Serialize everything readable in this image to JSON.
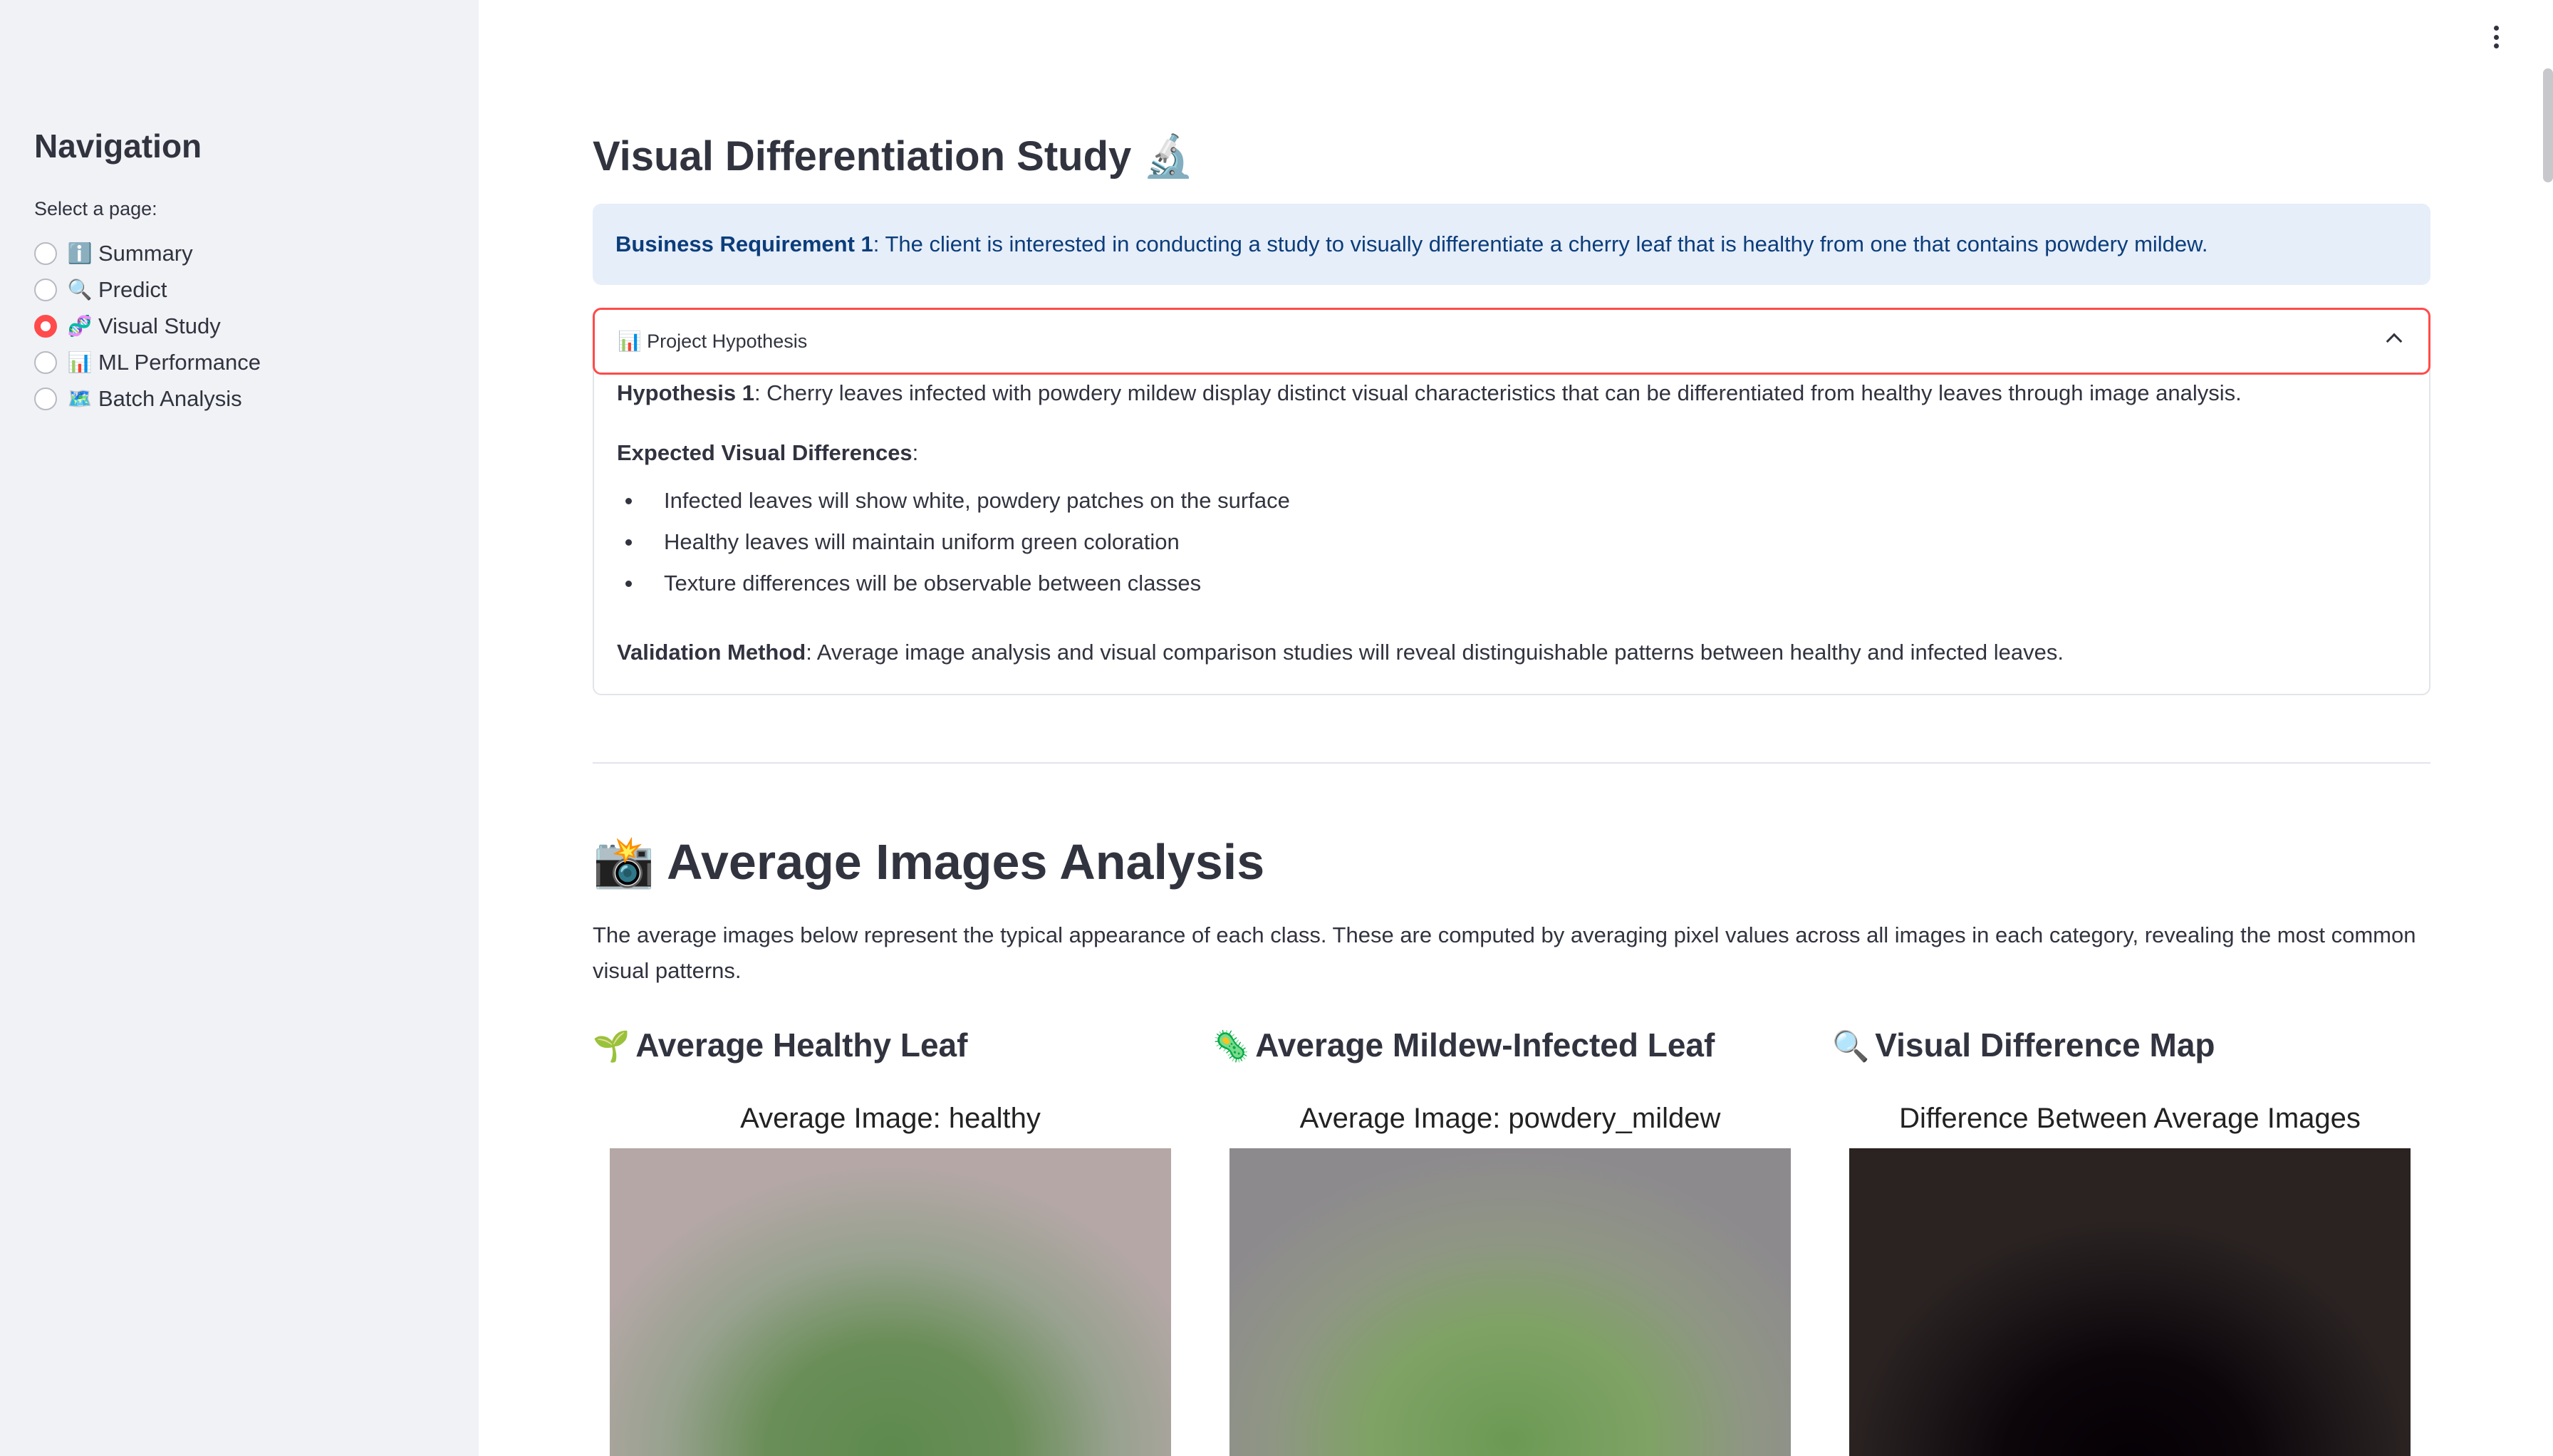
{
  "sidebar": {
    "title": "Navigation",
    "select_label": "Select a page:",
    "items": [
      {
        "icon": "ℹ️",
        "label": "Summary",
        "selected": false
      },
      {
        "icon": "🔍",
        "label": "Predict",
        "selected": false
      },
      {
        "icon": "🧬",
        "label": "Visual Study",
        "selected": true
      },
      {
        "icon": "📊",
        "label": "ML Performance",
        "selected": false
      },
      {
        "icon": "🗺️",
        "label": "Batch Analysis",
        "selected": false
      }
    ]
  },
  "main": {
    "title": "Visual Differentiation Study 🔬",
    "info": {
      "bold": "Business Requirement 1",
      "text": ": The client is interested in conducting a study to visually differentiate a cherry leaf that is healthy from one that contains powdery mildew."
    },
    "expander": {
      "header": "📊 Project Hypothesis",
      "hypothesis_bold": "Hypothesis 1",
      "hypothesis_text": ": Cherry leaves infected with powdery mildew display distinct visual characteristics that can be differentiated from healthy leaves through image analysis.",
      "expected_bold": "Expected Visual Differences",
      "expected_colon": ":",
      "bullets": [
        "Infected leaves will show white, powdery patches on the surface",
        "Healthy leaves will maintain uniform green coloration",
        "Texture differences will be observable between classes"
      ],
      "validation_bold": "Validation Method",
      "validation_text": ": Average image analysis and visual comparison studies will reveal distinguishable patterns between healthy and infected leaves."
    },
    "section": {
      "icon": "📸",
      "title": "Average Images Analysis",
      "description": "The average images below represent the typical appearance of each class. These are computed by averaging pixel values across all images in each category, revealing the most common visual patterns."
    },
    "columns": [
      {
        "icon": "🌱",
        "title": "Average Healthy Leaf",
        "figure_title": "Average Image: healthy"
      },
      {
        "icon": "🦠",
        "title": "Average Mildew-Infected Leaf",
        "figure_title": "Average Image: powdery_mildew"
      },
      {
        "icon": "🔍",
        "title": "Visual Difference Map",
        "figure_title": "Difference Between Average Images"
      }
    ]
  },
  "colors": {
    "accent": "#ff4b4b",
    "sidebar_bg": "#f0f2f6",
    "info_bg": "#e6eefa",
    "info_text": "#0b3d7a"
  }
}
